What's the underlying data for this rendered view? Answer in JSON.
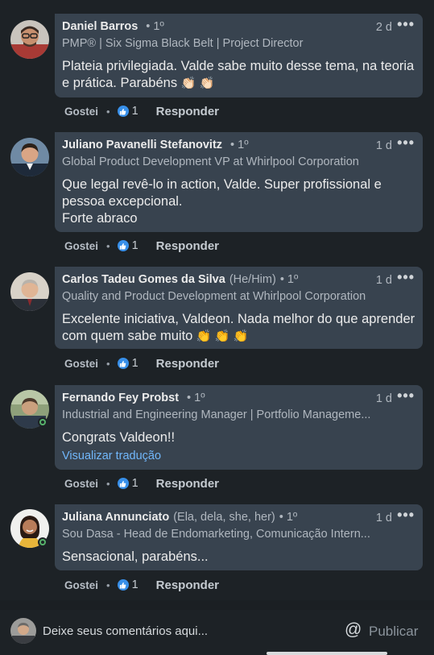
{
  "comments": [
    {
      "name": "Daniel Barros",
      "pronouns": "",
      "degree": "• 1º",
      "time": "2 d",
      "headline": "PMP® | Six Sigma Black Belt | Project Director",
      "text": "Plateia privilegiada. Valde sabe muito desse tema, na teoria e prática. Parabéns",
      "emoji": "👏🏻 👏🏻",
      "translate": "",
      "like_label": "Gostei",
      "reaction_count": "1",
      "reply_label": "Responder",
      "more_label": "•••"
    },
    {
      "name": "Juliano Pavanelli Stefanovitz",
      "pronouns": "",
      "degree": "• 1º",
      "time": "1 d",
      "headline": "Global Product Development VP at Whirlpool Corporation",
      "text": "Que legal revê-lo in action, Valde. Super profissional e pessoa excepcional.\nForte abraco",
      "emoji": "",
      "translate": "",
      "like_label": "Gostei",
      "reaction_count": "1",
      "reply_label": "Responder",
      "more_label": "•••"
    },
    {
      "name": "Carlos Tadeu Gomes da Silva",
      "pronouns": "(He/Him)",
      "degree": "• 1º",
      "time": "1 d",
      "headline": "Quality and Product Development at Whirlpool Corporation",
      "text": "Excelente iniciativa, Valdeon. Nada melhor do que aprender com quem sabe muito",
      "emoji": "👏 👏 👏",
      "translate": "",
      "like_label": "Gostei",
      "reaction_count": "1",
      "reply_label": "Responder",
      "more_label": "•••"
    },
    {
      "name": "Fernando Fey Probst",
      "pronouns": "",
      "degree": "• 1º",
      "time": "1 d",
      "headline": "Industrial and Engineering Manager | Portfolio Manageme...",
      "text": "Congrats Valdeon!!",
      "emoji": "",
      "translate": "Visualizar tradução",
      "like_label": "Gostei",
      "reaction_count": "1",
      "reply_label": "Responder",
      "more_label": "•••"
    },
    {
      "name": "Juliana Annunciato",
      "pronouns": "(Ela, dela, she, her)",
      "degree": "• 1º",
      "time": "1 d",
      "headline": "Sou Dasa - Head de Endomarketing, Comunicação Intern...",
      "text": "Sensacional, parabéns...",
      "emoji": "",
      "translate": "",
      "like_label": "Gostei",
      "reaction_count": "1",
      "reply_label": "Responder",
      "more_label": "•••"
    }
  ],
  "composer": {
    "placeholder": "Deixe seus comentários aqui...",
    "mention_icon": "@",
    "publish_label": "Publicar"
  },
  "colors": {
    "background": "#1d2226",
    "bubble": "#38434f",
    "accent_link": "#71b7fb",
    "reaction": "#378fe9",
    "online": "#57b26b"
  },
  "icons": {
    "reaction": "like-thumb-icon",
    "more": "more-options-icon",
    "mention": "at-sign-icon",
    "online": "online-status-icon"
  },
  "dot_separator": "•"
}
